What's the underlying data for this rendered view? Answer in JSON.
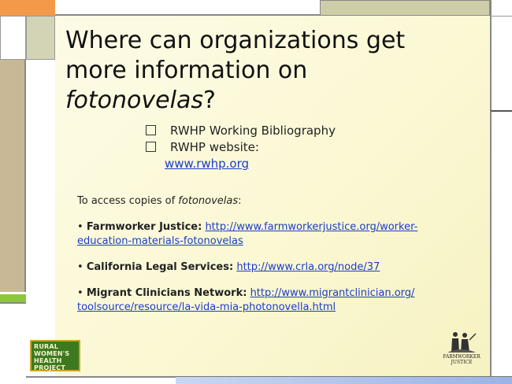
{
  "slide": {
    "title_line1": "Where can organizations get",
    "title_line2": "more information on",
    "title_italic": "fotonovelas",
    "title_suffix": "?",
    "bullets": [
      {
        "text": "RWHP Working Bibliography"
      },
      {
        "text": "RWHP website:",
        "link": "www.rwhp.org"
      }
    ],
    "access_intro": "To access copies of ",
    "access_italic": "fotonovelas",
    "access_colon": ":",
    "resources": [
      {
        "bullet": "• ",
        "name": "Farmworker Justice:",
        "link_l1": "http://www.farmworkerjustice.org/worker-",
        "link_l2": "education-materials-fotonovelas"
      },
      {
        "bullet": "• ",
        "name": "California Legal Services:",
        "link_l1": "http://www.crla.org/node/37"
      },
      {
        "bullet": "• ",
        "name": "Migrant Clinicians Network:",
        "link_l1": "http://www.migrantclinician.org/",
        "link_l2": "toolsource/resource/la-vida-mia-photonovella.html"
      }
    ]
  },
  "logos": {
    "left": [
      "RURAL",
      "WOMEN'S",
      "HEALTH",
      "PROJECT"
    ],
    "right": [
      "FARMWORKER",
      "JUSTICE"
    ]
  },
  "colors": {
    "green": "#8dc63f",
    "tan": "#c8b896",
    "olive": "#cfcda8",
    "orange": "#f2994a",
    "blue": "#9bb3e3",
    "link": "#1a3cc9"
  }
}
